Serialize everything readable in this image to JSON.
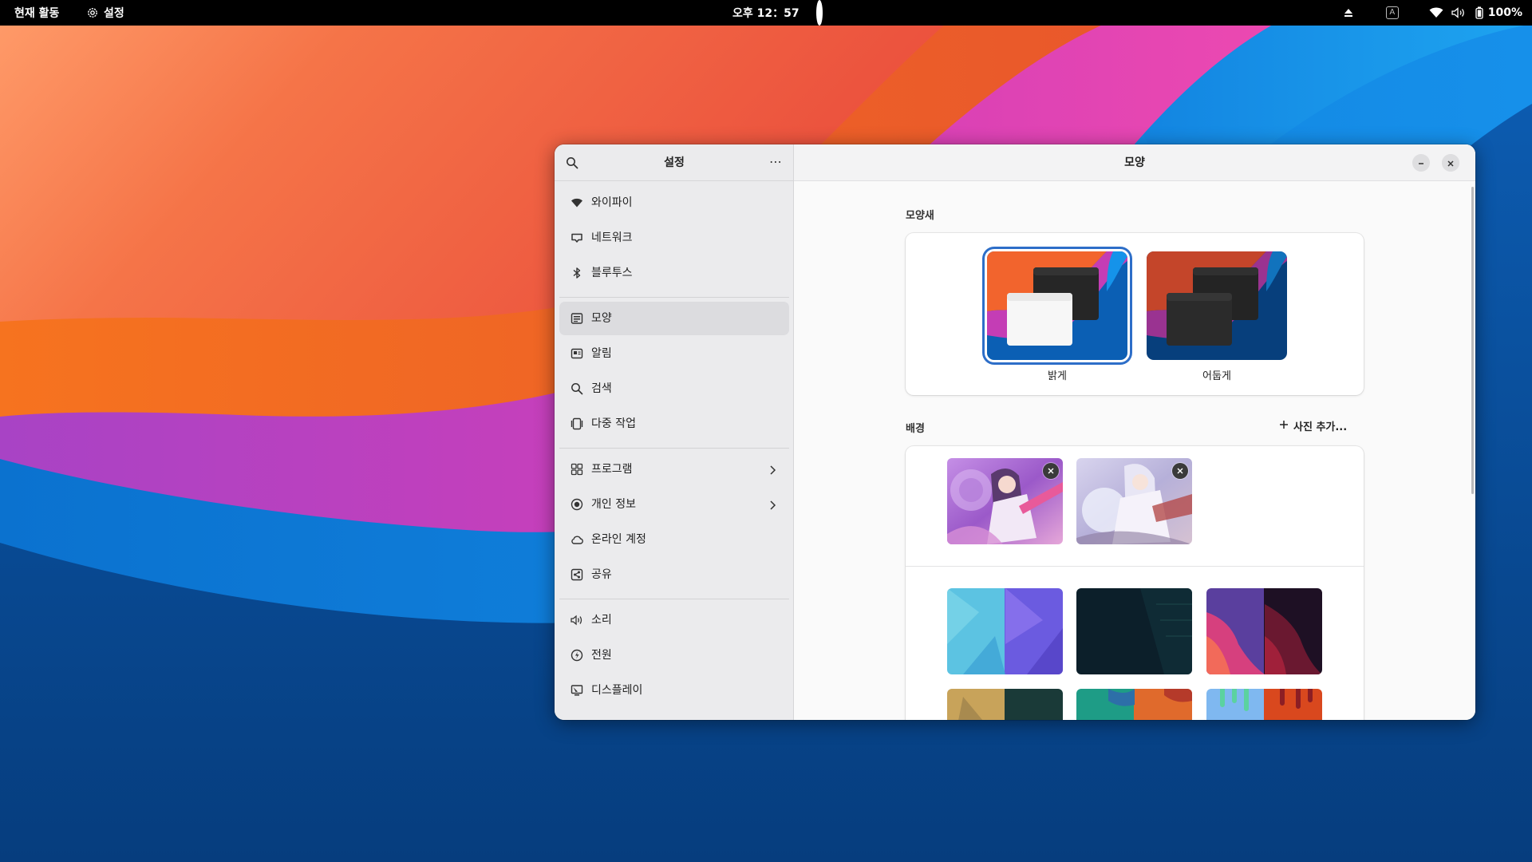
{
  "topbar": {
    "activities": "현재 활동",
    "app_name": "설정",
    "clock": "오후 12：57",
    "battery": "100%",
    "icons": [
      "eject-icon",
      "keyboard-layout-icon",
      "wifi-icon",
      "volume-icon",
      "battery-icon"
    ],
    "keyboard_layout": "A"
  },
  "sidebar": {
    "title": "설정",
    "menu": "⋯",
    "groups": [
      [
        {
          "label": "와이파이",
          "icon": "wifi-icon"
        },
        {
          "label": "네트워크",
          "icon": "network-icon"
        },
        {
          "label": "블루투스",
          "icon": "bluetooth-icon"
        }
      ],
      [
        {
          "label": "모양",
          "icon": "appearance-icon",
          "selected": true
        },
        {
          "label": "알림",
          "icon": "notifications-icon"
        },
        {
          "label": "검색",
          "icon": "search-icon"
        },
        {
          "label": "다중 작업",
          "icon": "multitasking-icon"
        }
      ],
      [
        {
          "label": "프로그램",
          "icon": "apps-icon",
          "chevron": true
        },
        {
          "label": "개인 정보",
          "icon": "privacy-icon",
          "chevron": true
        },
        {
          "label": "온라인 계정",
          "icon": "cloud-icon"
        },
        {
          "label": "공유",
          "icon": "sharing-icon"
        }
      ],
      [
        {
          "label": "소리",
          "icon": "sound-icon"
        },
        {
          "label": "전원",
          "icon": "power-icon"
        },
        {
          "label": "디스플레이",
          "icon": "display-icon"
        }
      ]
    ]
  },
  "content": {
    "title": "모양",
    "style_section": "모양새",
    "styles": [
      {
        "label": "밝게",
        "selected": true
      },
      {
        "label": "어둡게",
        "selected": false
      }
    ],
    "background_section": "배경",
    "add_photo": "사진 추가...",
    "custom_backgrounds": 2,
    "preset_backgrounds": 6
  },
  "colors": {
    "accent": "#2d6ec8",
    "sidebar_bg": "#ebebed",
    "content_bg": "#fafafa",
    "selected_row": "#dcdcdf",
    "wallpaper_orange": "#f4622e",
    "wallpaper_magenta": "#c93fb4",
    "wallpaper_blue": "#0a6fd0"
  }
}
